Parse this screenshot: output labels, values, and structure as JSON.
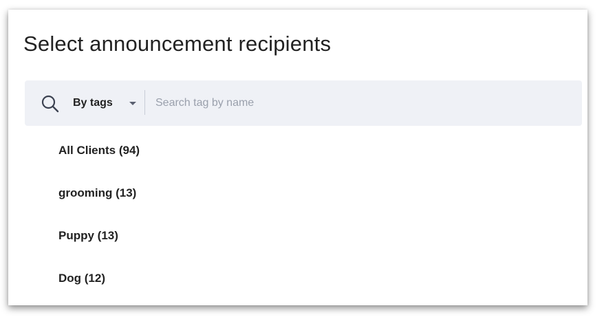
{
  "dialog": {
    "title": "Select announcement recipients"
  },
  "search": {
    "icon": "search-icon",
    "filter_label": "By tags",
    "placeholder": "Search tag by name",
    "value": ""
  },
  "tags": [
    {
      "label": "All Clients (94)"
    },
    {
      "label": "grooming (13)"
    },
    {
      "label": "Puppy (13)"
    },
    {
      "label": "Dog (12)"
    }
  ],
  "colors": {
    "search_bar_bg": "#eff1f6",
    "text": "#222222",
    "placeholder": "#9aa0ac",
    "icon": "#3b4150"
  }
}
